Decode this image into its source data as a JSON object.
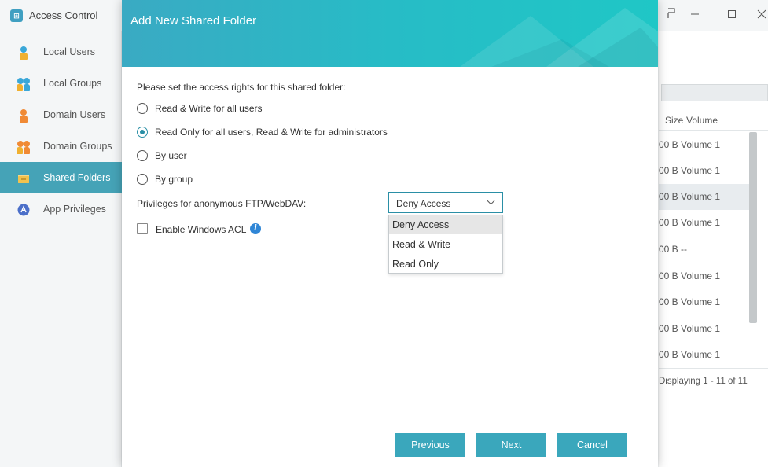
{
  "app": {
    "title": "Access Control",
    "icon": "access-control-icon",
    "controls": [
      "window-menu-icon",
      "minimize-icon",
      "maximize-icon",
      "close-icon"
    ]
  },
  "sidebar": {
    "items": [
      {
        "label": "Local Users",
        "icon": "user-icon",
        "active": false
      },
      {
        "label": "Local Groups",
        "icon": "group-icon",
        "active": false
      },
      {
        "label": "Domain Users",
        "icon": "user-icon",
        "active": false
      },
      {
        "label": "Domain Groups",
        "icon": "group-icon",
        "active": false
      },
      {
        "label": "Shared Folders",
        "icon": "folder-icon",
        "active": true
      },
      {
        "label": "App Privileges",
        "icon": "app-privileges-icon",
        "active": false
      }
    ]
  },
  "background_table": {
    "headers": {
      "size": "Size",
      "volume": "Volume"
    },
    "rows": [
      {
        "text": "00 B  Volume 1",
        "selected": false
      },
      {
        "text": "00 B  Volume 1",
        "selected": false
      },
      {
        "text": "00 B  Volume 1",
        "selected": true
      },
      {
        "text": "00 B  Volume 1",
        "selected": false
      },
      {
        "text": "00 B  --",
        "selected": false
      },
      {
        "text": "00 B  Volume 1",
        "selected": false
      },
      {
        "text": "00 B  Volume 1",
        "selected": false
      },
      {
        "text": "00 B  Volume 1",
        "selected": false
      },
      {
        "text": "00 B  Volume 1",
        "selected": false
      }
    ],
    "footer": "Displaying 1 - 11 of 11"
  },
  "modal": {
    "title": "Add New Shared Folder",
    "prompt": "Please set the access rights for this shared folder:",
    "radios": [
      {
        "label": "Read & Write for all users",
        "checked": false
      },
      {
        "label": "Read Only for all users, Read & Write for administrators",
        "checked": true
      },
      {
        "label": "By user",
        "checked": false
      },
      {
        "label": "By group",
        "checked": false
      }
    ],
    "privileges_label": "Privileges for anonymous FTP/WebDAV:",
    "privileges_value": "Deny Access",
    "privileges_options": [
      "Deny Access",
      "Read & Write",
      "Read Only"
    ],
    "acl_label": "Enable Windows ACL",
    "buttons": {
      "previous": "Previous",
      "next": "Next",
      "cancel": "Cancel"
    }
  },
  "colors": {
    "accent": "#3aa7bc",
    "active_sidebar": "#45a3b7",
    "header_gradient_start": "#3aaac3",
    "header_gradient_end": "#1fc7c6",
    "user_icon_orange": "#f08a35",
    "user_icon_blue": "#3aa7d8"
  }
}
